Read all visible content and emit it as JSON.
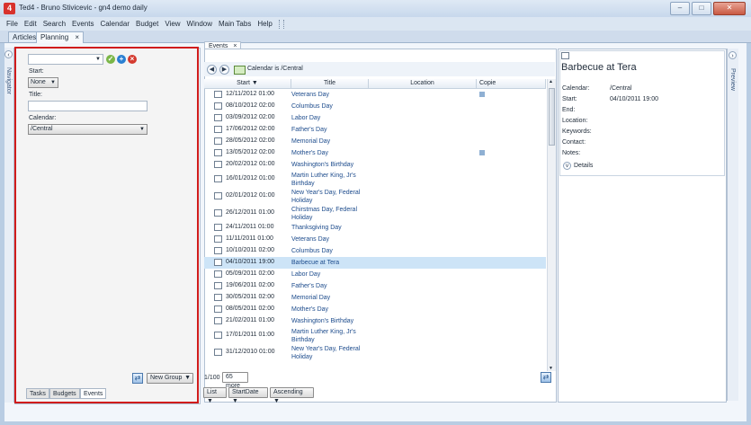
{
  "window": {
    "app_icon": "4",
    "title": "Ted4 - Bruno Stivicevic - gn4 demo daily",
    "controls": [
      "–",
      "□",
      "✕"
    ]
  },
  "menu": [
    "File",
    "Edit",
    "Search",
    "Events",
    "Calendar",
    "Budget",
    "View",
    "Window",
    "Main Tabs",
    "Help"
  ],
  "main_tabs": [
    {
      "label": "Articles",
      "closable": false
    },
    {
      "label": "Planning",
      "closable": true,
      "close": "×"
    }
  ],
  "navigator": {
    "side_label": "Navigator",
    "collapse": "‹",
    "start_label": "Start:",
    "start_value": "None",
    "title_label": "Title:",
    "title_value": "",
    "calendar_label": "Calendar:",
    "calendar_value": "/Central",
    "new_group": "New Group",
    "tabs": [
      "Tasks",
      "Budgets",
      "Events"
    ]
  },
  "events": {
    "tab_label": "Events",
    "tab_close": "×",
    "filter_text": "Calendar is /Central",
    "columns": [
      "Start",
      "Title",
      "Location",
      "Copie"
    ],
    "rows": [
      {
        "start": "12/11/2012 01:00",
        "title": "Veterans Day",
        "copy": true
      },
      {
        "start": "08/10/2012 02:00",
        "title": "Columbus Day",
        "copy": false
      },
      {
        "start": "03/09/2012 02:00",
        "title": "Labor Day",
        "copy": false
      },
      {
        "start": "17/06/2012 02:00",
        "title": "Father's Day",
        "copy": false
      },
      {
        "start": "28/05/2012 02:00",
        "title": "Memorial Day",
        "copy": false
      },
      {
        "start": "13/05/2012 02:00",
        "title": "Mother's Day",
        "copy": true
      },
      {
        "start": "20/02/2012 01:00",
        "title": "Washington's Birthday",
        "copy": false
      },
      {
        "start": "16/01/2012 01:00",
        "title": "Martin Luther King, Jr's Birthday",
        "copy": false
      },
      {
        "start": "02/01/2012 01:00",
        "title": "New Year's Day, Federal Holiday",
        "copy": false
      },
      {
        "start": "26/12/2011 01:00",
        "title": "Chirstmas Day, Federal Holiday",
        "copy": false
      },
      {
        "start": "24/11/2011 01:00",
        "title": "Thanksgiving Day",
        "copy": false
      },
      {
        "start": "11/11/2011 01:00",
        "title": "Veterans Day",
        "copy": false
      },
      {
        "start": "10/10/2011 02:00",
        "title": "Columbus Day",
        "copy": false
      },
      {
        "start": "04/10/2011 19:00",
        "title": "Barbecue at Tera",
        "copy": false
      },
      {
        "start": "05/09/2011 02:00",
        "title": "Labor Day",
        "copy": false
      },
      {
        "start": "19/06/2011 02:00",
        "title": "Father's Day",
        "copy": false
      },
      {
        "start": "30/05/2011 02:00",
        "title": "Memorial Day",
        "copy": false
      },
      {
        "start": "08/05/2011 02:00",
        "title": "Mother's Day",
        "copy": false
      },
      {
        "start": "21/02/2011 01:00",
        "title": "Washington's Birthday",
        "copy": false
      },
      {
        "start": "17/01/2011 01:00",
        "title": "Martin Luther King, Jr's Birthday",
        "copy": false
      },
      {
        "start": "31/12/2010 01:00",
        "title": "New Year's Day, Federal Holiday",
        "copy": false
      }
    ],
    "selected_index": 13,
    "pager": "1/100",
    "more": "65 more",
    "view_mode": "List",
    "sort_field": "StartDate",
    "sort_order": "Ascending"
  },
  "detail": {
    "title": "Barbecue at Tera",
    "calendar_label": "Calendar:",
    "calendar": "/Central",
    "start_label": "Start:",
    "start": "04/10/2011 19:00",
    "end_label": "End:",
    "location_label": "Location:",
    "keywords_label": "Keywords:",
    "contact_label": "Contact:",
    "notes_label": "Notes:",
    "details_label": "Details",
    "preview_label": "Preview",
    "expand": "›"
  },
  "colors": {
    "highlight": "#d01c1c",
    "selection": "#cde4f7",
    "link": "#1c4b8c"
  }
}
